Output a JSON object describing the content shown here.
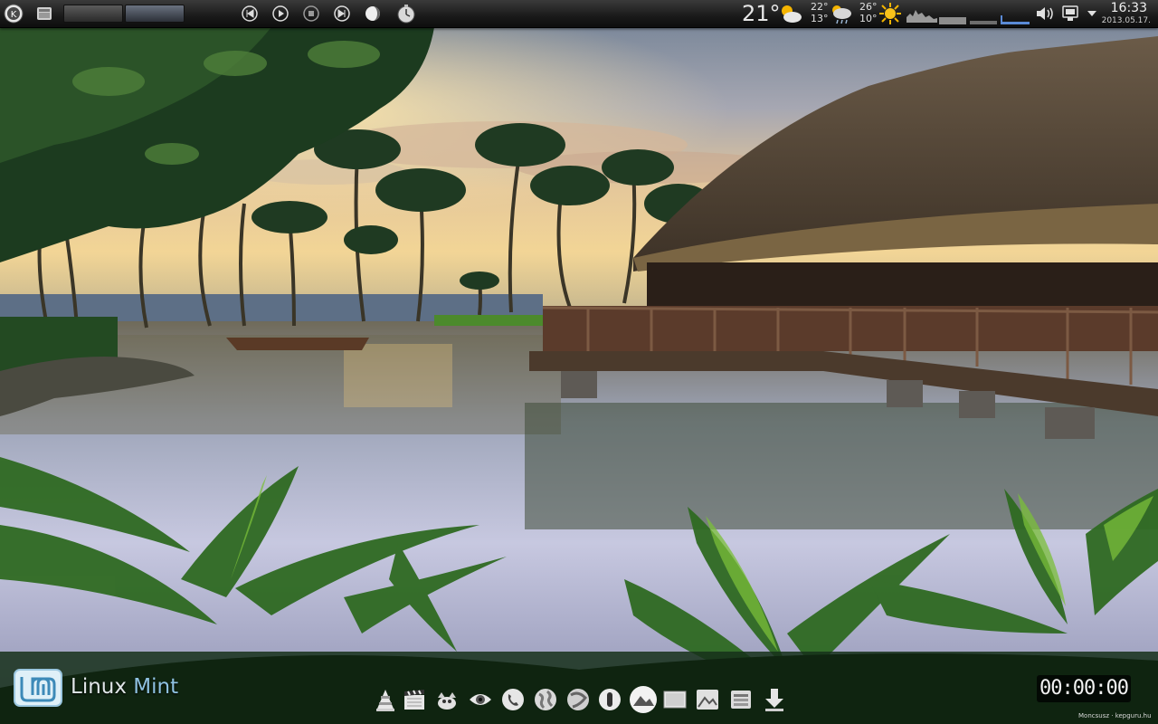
{
  "top_panel": {
    "weather": {
      "current_temp": "21°",
      "day2_high": "22°",
      "day2_low": "13°",
      "day3_high": "26°",
      "day3_low": "10°"
    },
    "clock": {
      "time": "16:33",
      "date": "2013.05.17."
    },
    "icons": [
      "kde-menu-icon",
      "show-desktop-icon",
      "media-previous-icon",
      "media-play-icon",
      "media-stop-icon",
      "media-next-icon",
      "moon-icon",
      "timer-icon",
      "partly-cloudy-icon",
      "cloud-rain-icon",
      "sun-icon",
      "cpu-graph-icon",
      "network-graph-icon",
      "volume-icon",
      "network-manager-icon",
      "panel-menu-icon"
    ]
  },
  "desktop": {
    "branding": {
      "prefix": "Linux",
      "suffix": "Mint"
    },
    "timer": "00:00:00",
    "credit": "Moncsusz · kepguru.hu"
  },
  "dock": {
    "icons": [
      "vlc-icon",
      "clapperboard-icon",
      "gimp-icon",
      "eye-icon",
      "phone-icon",
      "globe-icon",
      "network-globe-icon",
      "info-icon",
      "picture-icon",
      "terminal-icon",
      "image-viewer-icon",
      "file-manager-icon",
      "download-icon"
    ]
  },
  "colors": {
    "accent_mint": "#8fc2e2",
    "panel_bg": "#1a1a1a"
  }
}
